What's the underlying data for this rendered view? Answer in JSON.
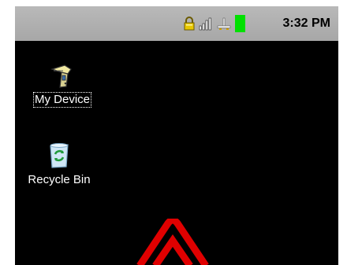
{
  "status_bar": {
    "time": "3:32 PM",
    "icons": [
      "lock-icon",
      "signal-strength-icon",
      "network-icon",
      "battery-icon"
    ],
    "battery_color": "#00e000"
  },
  "desktop": {
    "icons": [
      {
        "label": "My Device",
        "icon": "handheld-device-icon",
        "selected": true
      },
      {
        "label": "Recycle Bin",
        "icon": "recycle-bin-icon",
        "selected": false
      }
    ],
    "wallpaper_logo_color": "#e00000"
  }
}
